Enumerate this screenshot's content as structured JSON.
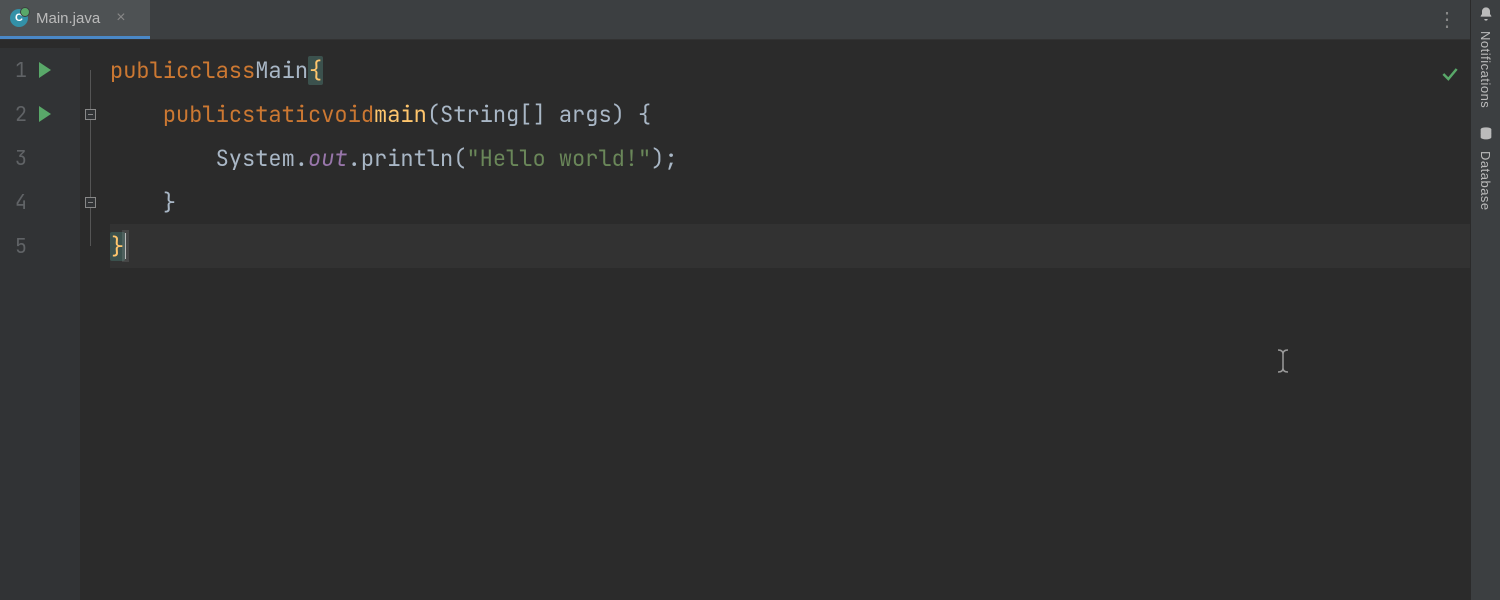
{
  "tab": {
    "filename": "Main.java",
    "close_glyph": "×",
    "menu_glyph": "⋮"
  },
  "gutter": {
    "lines": [
      "1",
      "2",
      "3",
      "4",
      "5"
    ]
  },
  "code": {
    "line1": {
      "kw1": "public",
      "kw2": "class",
      "name": "Main",
      "brace": "{"
    },
    "line2": {
      "indent": "    ",
      "kw1": "public",
      "kw2": "static",
      "kw3": "void",
      "method": "main",
      "params": "(String[] args) {"
    },
    "line3": {
      "indent": "        ",
      "sys": "System.",
      "out": "out",
      "dot": ".println(",
      "str": "\"Hello world!\"",
      "end": ");"
    },
    "line4": {
      "indent": "    ",
      "brace": "}"
    },
    "line5": {
      "brace": "}"
    }
  },
  "status": {
    "check": "✓"
  },
  "sidebar": {
    "notifications": "Notifications",
    "database": "Database"
  }
}
